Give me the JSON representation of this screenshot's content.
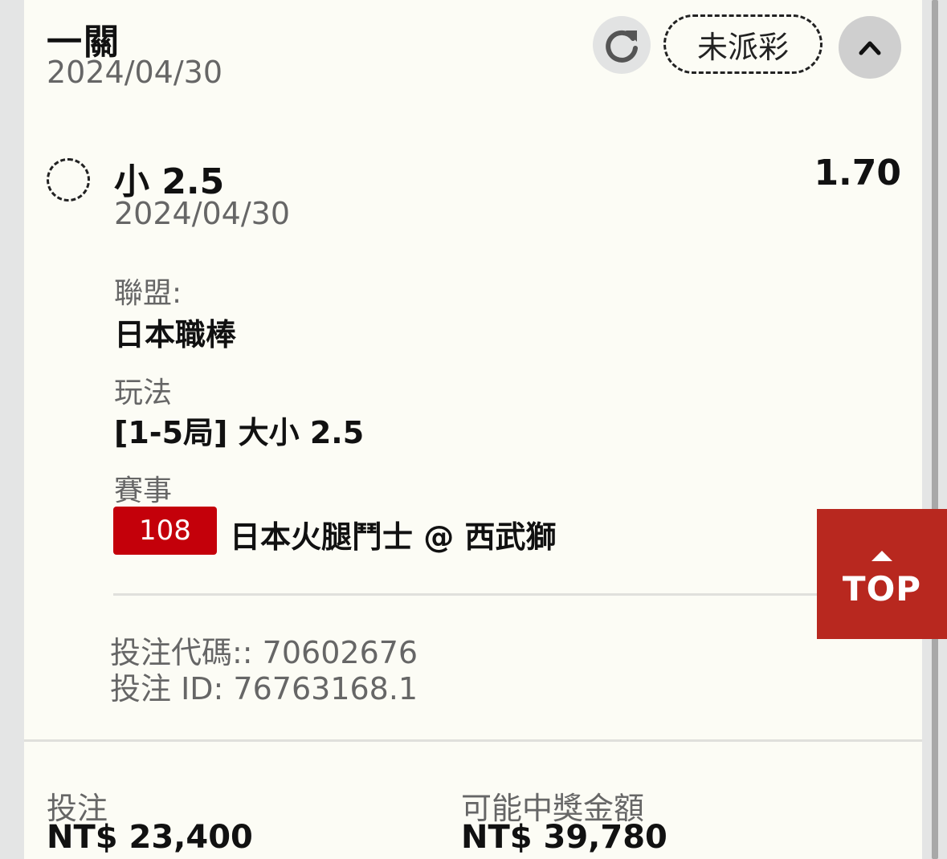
{
  "header": {
    "bet_type": "一關",
    "date": "2024/04/30",
    "status": "未派彩"
  },
  "selection": {
    "name": "小 2.5",
    "odds": "1.70",
    "date": "2024/04/30"
  },
  "details": {
    "league_label": "聯盟:",
    "league": "日本職棒",
    "market_label": "玩法",
    "market": "[1-5局] 大小 2.5",
    "event_label": "賽事",
    "match_number": "108",
    "match": "日本火腿鬥士 @ 西武獅"
  },
  "ticket": {
    "code_line": "投注代碼:: 70602676",
    "id_line": "投注 ID: 76763168.1"
  },
  "footer": {
    "stake_label": "投注",
    "stake": "NT$ 23,400",
    "payout_label": "可能中獎金額",
    "payout": "NT$ 39,780"
  },
  "top_button": {
    "label": "TOP"
  },
  "colors": {
    "accent_red": "#c4000a",
    "top_button": "#b8281f",
    "card_bg": "#fcfcf5"
  }
}
